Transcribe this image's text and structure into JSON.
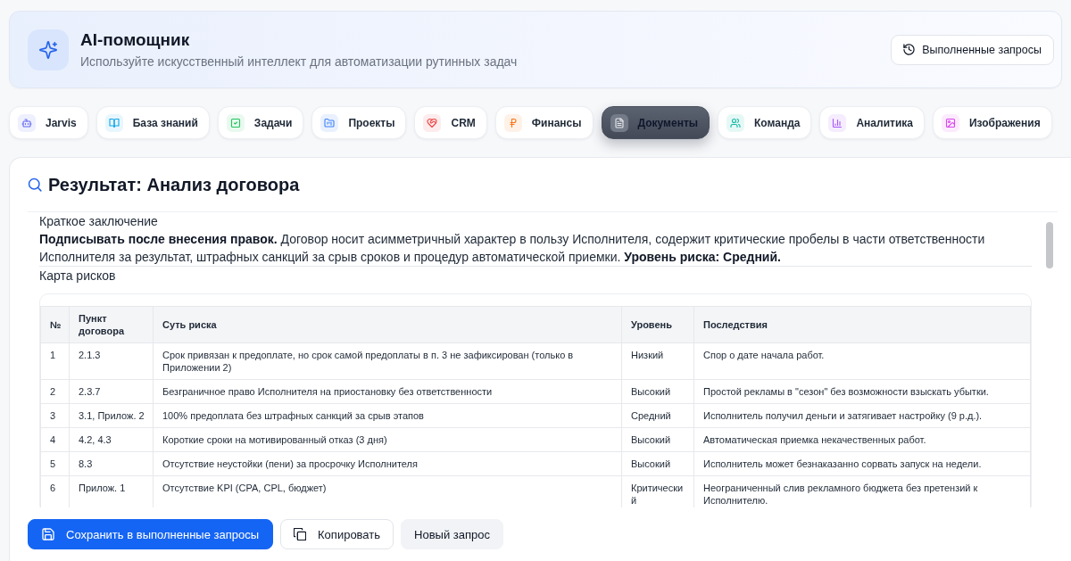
{
  "header": {
    "title": "AI-помощник",
    "subtitle": "Используйте искусственный интеллект для автоматизации рутинных задач",
    "history_button": "Выполненные запросы"
  },
  "tabs": [
    {
      "label": "Jarvis",
      "selected": false
    },
    {
      "label": "База знаний",
      "selected": false
    },
    {
      "label": "Задачи",
      "selected": false
    },
    {
      "label": "Проекты",
      "selected": false
    },
    {
      "label": "CRM",
      "selected": false
    },
    {
      "label": "Финансы",
      "selected": false
    },
    {
      "label": "Документы",
      "selected": true
    },
    {
      "label": "Команда",
      "selected": false
    },
    {
      "label": "Аналитика",
      "selected": false
    },
    {
      "label": "Изображения",
      "selected": false
    }
  ],
  "result": {
    "title": "Результат: Анализ договора",
    "summary_heading": "Краткое заключение",
    "summary": "**Подписывать после внесения правок.** Договор носит асимметричный характер в пользу Исполнителя, содержит критические пробелы в части ответственности Исполнителя за результат, штрафных санкций за срыв сроков и процедур автоматической приемки. **Уровень риска: Средний.**",
    "risk_map_heading": "Карта рисков",
    "table": {
      "columns": [
        "№",
        "Пункт договора",
        "Суть риска",
        "Уровень",
        "Последствия"
      ],
      "rows": [
        [
          "1",
          "2.1.3",
          "Срок привязан к предоплате, но срок самой предоплаты в п. 3 не зафиксирован (только в Приложении 2)",
          "Низкий",
          "Спор о дате начала работ."
        ],
        [
          "2",
          "2.3.7",
          "Безграничное право Исполнителя на приостановку без ответственности",
          "Высокий",
          "Простой рекламы в \"сезон\" без возможности взыскать убытки."
        ],
        [
          "3",
          "3.1, Прилож. 2",
          "100% предоплата без штрафных санкций за срыв этапов",
          "Средний",
          "Исполнитель получил деньги и затягивает настройку (9 р.д.)."
        ],
        [
          "4",
          "4.2, 4.3",
          "Короткие сроки на мотивированный отказ (3 дня)",
          "Высокий",
          "Автоматическая приемка некачественных работ."
        ],
        [
          "5",
          "8.3",
          "Отсутствие неустойки (пени) за просрочку Исполнителя",
          "Высокий",
          "Исполнитель может безнаказанно сорвать запуск на недели."
        ],
        [
          "6",
          "Прилож. 1",
          "Отсутствие KPI (CPA, CPL, бюджет)",
          "Критический",
          "Неограниченный слив рекламного бюджета без претензий к Исполнителю."
        ]
      ]
    }
  },
  "actions": [
    {
      "kind": "primary",
      "label": "Сохранить в выполненные запросы"
    },
    {
      "kind": "outline",
      "label": "Копировать"
    },
    {
      "kind": "plain",
      "label": "Новый запрос"
    }
  ]
}
